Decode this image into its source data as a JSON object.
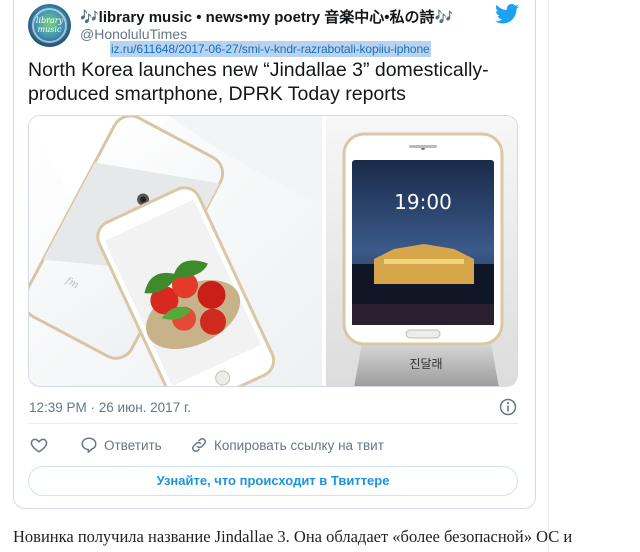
{
  "tweet": {
    "display_name": "🎶library music • news•my poetry 音楽中心•私の詩🎶",
    "handle": "@HonoluluTimes",
    "avatar_text": "library music",
    "link": "iz.ru/611648/2017-06-27/smi-v-kndr-razrabotali-kopiiu-iphone",
    "title": "North Korea launches new “Jindallae 3” domestically-produced smartphone, DPRK Today reports",
    "phone_clock": "19:00",
    "dock_label": "진달래",
    "timestamp": "12:39 PM · 26 июн. 2017 г.",
    "actions": {
      "reply_label": "Ответить",
      "share_label": "Копировать ссылку на твит"
    },
    "cta_label": "Узнайте, что происходит в Твиттере"
  },
  "article": {
    "first_line": "Новинка получила название Jindallae 3. Она обладает «более безопасной» ОС и"
  },
  "colors": {
    "twitter_blue": "#1da1f2",
    "link_text": "#1b6fb8",
    "link_highlight": "#b8d3ef",
    "muted": "#657786"
  }
}
